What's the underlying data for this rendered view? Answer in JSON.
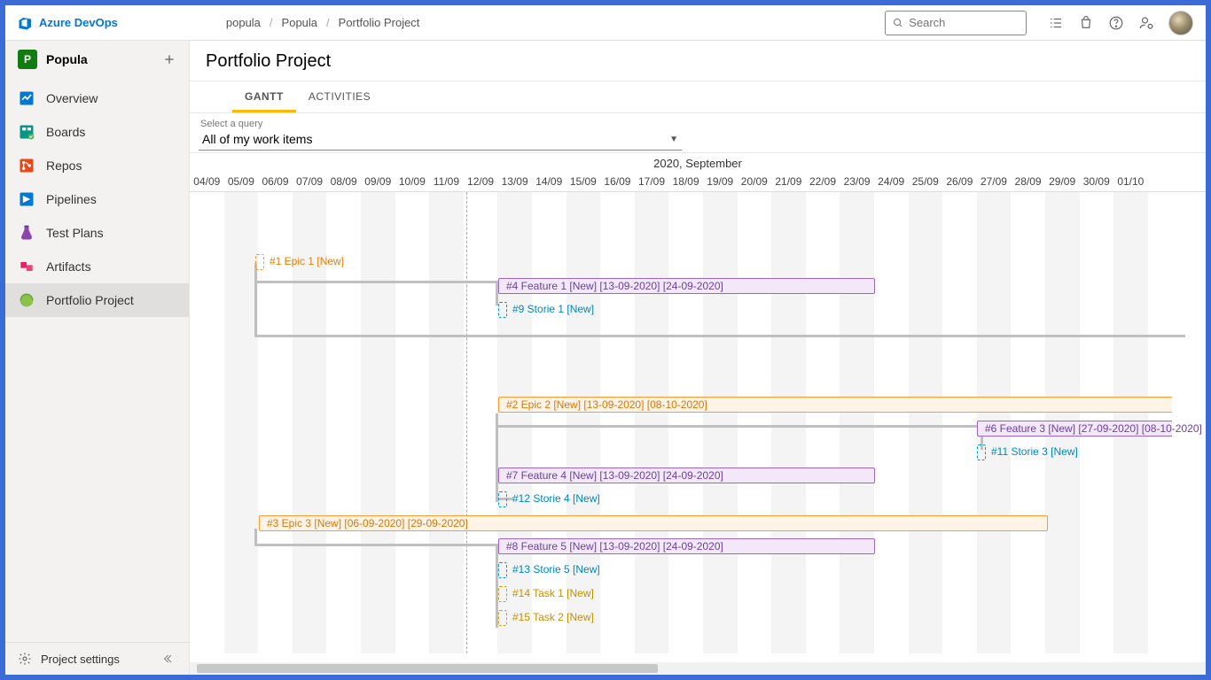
{
  "brand": "Azure DevOps",
  "breadcrumbs": [
    "popula",
    "Popula",
    "Portfolio Project"
  ],
  "search_placeholder": "Search",
  "project": {
    "badge": "P",
    "name": "Popula"
  },
  "nav": [
    {
      "label": "Overview"
    },
    {
      "label": "Boards"
    },
    {
      "label": "Repos"
    },
    {
      "label": "Pipelines"
    },
    {
      "label": "Test Plans"
    },
    {
      "label": "Artifacts"
    },
    {
      "label": "Portfolio Project",
      "selected": true
    }
  ],
  "footer_label": "Project settings",
  "page_title": "Portfolio Project",
  "tabs": [
    {
      "label": "GANTT",
      "active": true
    },
    {
      "label": "ACTIVITIES"
    }
  ],
  "query_label": "Select a query",
  "query_value": "All of my work items",
  "timeline_month": "2020, September",
  "timeline_days": [
    "04/09",
    "05/09",
    "06/09",
    "07/09",
    "08/09",
    "09/09",
    "10/09",
    "11/09",
    "12/09",
    "13/09",
    "14/09",
    "15/09",
    "16/09",
    "17/09",
    "18/09",
    "19/09",
    "20/09",
    "21/09",
    "22/09",
    "23/09",
    "24/09",
    "25/09",
    "26/09",
    "27/09",
    "28/09",
    "29/09",
    "30/09",
    "01/10"
  ],
  "colors": {
    "epic": "#ff9933",
    "feature": "#9966cc",
    "story": "#0099cc",
    "task": "#d4a017"
  },
  "items": {
    "epic1": "#1 Epic 1 [New]",
    "feature4": "#4 Feature 1 [New] [13-09-2020] [24-09-2020]",
    "story9": "#9 Storie 1 [New]",
    "epic2": "#2 Epic 2 [New] [13-09-2020] [08-10-2020]",
    "feature6": "#6 Feature 3 [New] [27-09-2020] [08-10-2020]",
    "story11": "#11 Storie 3 [New]",
    "feature7": "#7 Feature 4 [New] [13-09-2020] [24-09-2020]",
    "story12": "#12 Storie 4 [New]",
    "epic3": "#3 Epic 3 [New] [06-09-2020] [29-09-2020]",
    "feature8": "#8 Feature 5 [New] [13-09-2020] [24-09-2020]",
    "story13": "#13 Storie 5 [New]",
    "task14": "#14 Task 1 [New]",
    "task15": "#15 Task 2 [New]"
  }
}
